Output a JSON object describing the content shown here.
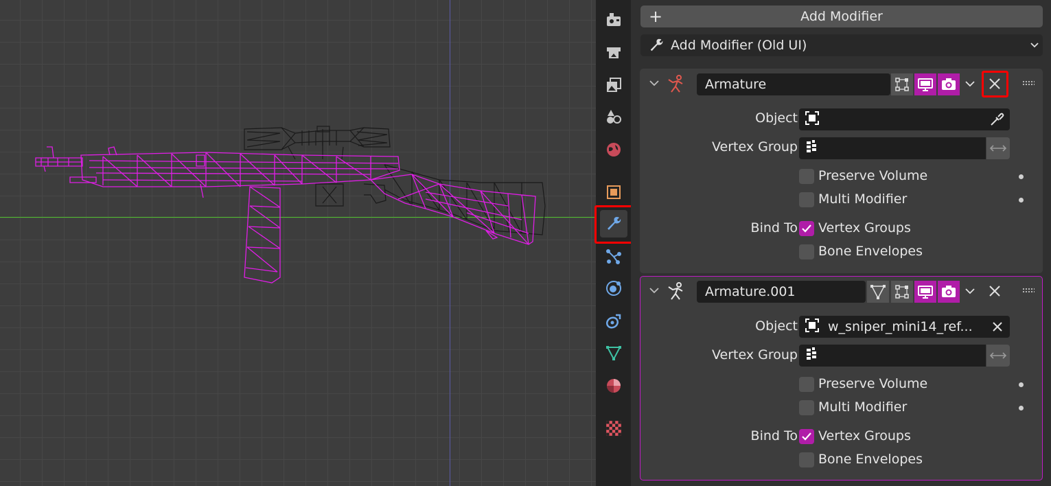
{
  "toolbar": {
    "add_modifier": "Add Modifier",
    "add_modifier_old": "Add Modifier (Old UI)"
  },
  "property_tabs": [
    {
      "name": "render-icon"
    },
    {
      "name": "output-icon"
    },
    {
      "name": "view-layer-icon"
    },
    {
      "name": "scene-icon"
    },
    {
      "name": "world-icon"
    },
    {
      "name": "object-icon"
    },
    {
      "name": "modifier-wrench-icon",
      "active": true
    },
    {
      "name": "particles-icon"
    },
    {
      "name": "physics-icon"
    },
    {
      "name": "constraints-icon"
    },
    {
      "name": "object-data-mesh-icon"
    },
    {
      "name": "material-icon"
    },
    {
      "name": "texture-icon"
    }
  ],
  "modifiers": [
    {
      "name": "Armature",
      "object_label": "Object",
      "object_value": "",
      "vertex_group_label": "Vertex Group",
      "vertex_group_value": "",
      "preserve_volume": "Preserve Volume",
      "preserve_volume_checked": false,
      "multi_modifier": "Multi Modifier",
      "multi_modifier_checked": false,
      "bind_to_label": "Bind To",
      "vertex_groups": "Vertex Groups",
      "vertex_groups_checked": true,
      "bone_envelopes": "Bone Envelopes",
      "bone_envelopes_checked": false
    },
    {
      "name": "Armature.001",
      "object_label": "Object",
      "object_value": "w_sniper_mini14_ref...",
      "vertex_group_label": "Vertex Group",
      "vertex_group_value": "",
      "preserve_volume": "Preserve Volume",
      "preserve_volume_checked": false,
      "multi_modifier": "Multi Modifier",
      "multi_modifier_checked": false,
      "bind_to_label": "Bind To",
      "vertex_groups": "Vertex Groups",
      "vertex_groups_checked": true,
      "bone_envelopes": "Bone Envelopes",
      "bone_envelopes_checked": false
    }
  ],
  "colors": {
    "selection_magenta": "#c01bc6",
    "toggle_on": "#b01da8",
    "highlight_red": "#ff0000",
    "axis_x_green": "#4fbf2c",
    "axis_z_blue": "#5a5aa8",
    "wire_selected": "#e01ee6",
    "wire_unselected": "#1a1a1a"
  }
}
